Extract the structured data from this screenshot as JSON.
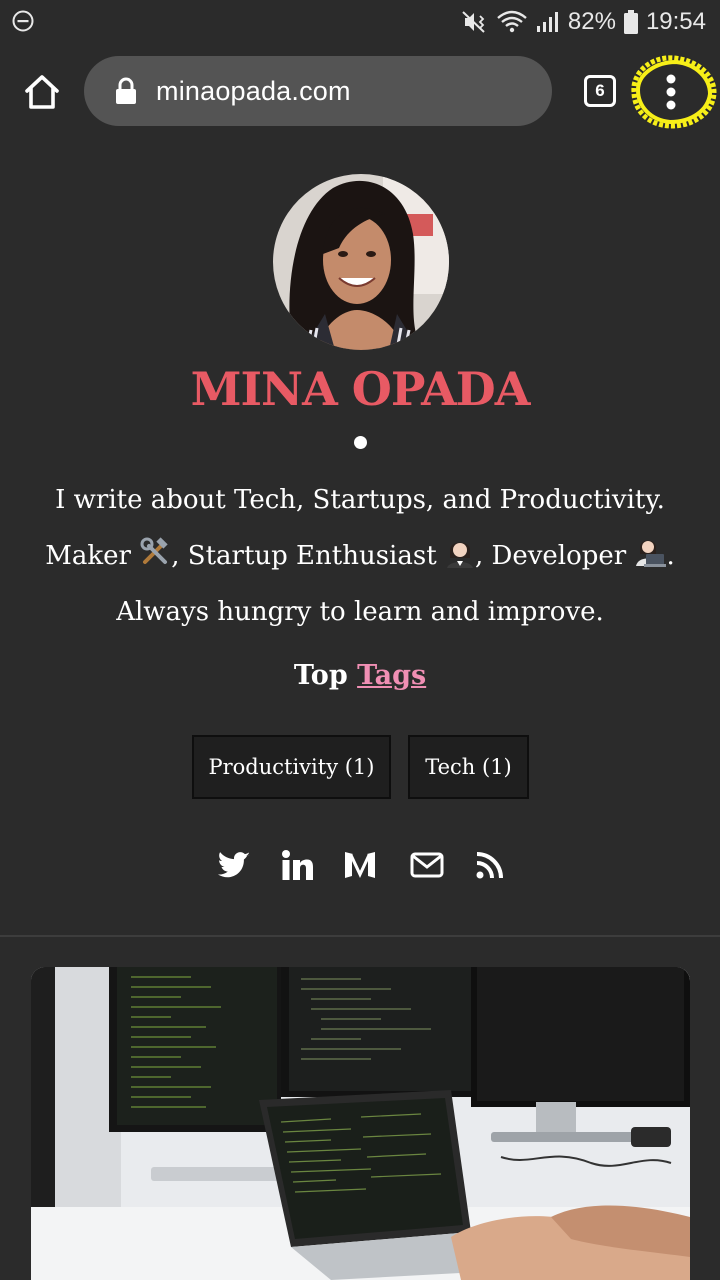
{
  "status_bar": {
    "battery_percent": "82%",
    "time": "19:54",
    "icons": [
      "do-not-disturb-icon",
      "mute-vibrate-icon",
      "wifi-icon",
      "signal-icon",
      "battery-icon"
    ]
  },
  "browser": {
    "url": "minaopada.com",
    "tab_count": "6",
    "icons": [
      "home-icon",
      "lock-icon",
      "tabs-icon",
      "menu-dots-icon"
    ],
    "highlight_color": "#f7ef18"
  },
  "profile": {
    "name": "MINA OPADA",
    "name_color": "#e85a64",
    "bio_line1": "I write about Tech, Startups, and Productivity.",
    "bio_maker": "Maker ",
    "bio_startup": ", Startup Enthusiast ",
    "bio_developer": ", Developer ",
    "bio_end": ".",
    "bio_line3": "Always hungry to learn and improve.",
    "bio_emojis": [
      "hammer-wrench-emoji",
      "office-worker-emoji",
      "technologist-emoji"
    ]
  },
  "tags": {
    "heading_prefix": "Top ",
    "heading_link": "Tags",
    "items": [
      {
        "label": "Productivity (1)"
      },
      {
        "label": "Tech (1)"
      }
    ]
  },
  "social_icons": [
    "twitter-icon",
    "linkedin-icon",
    "medium-icon",
    "email-icon",
    "rss-icon"
  ],
  "post": {
    "image_description_icon": "post-cover-image"
  }
}
